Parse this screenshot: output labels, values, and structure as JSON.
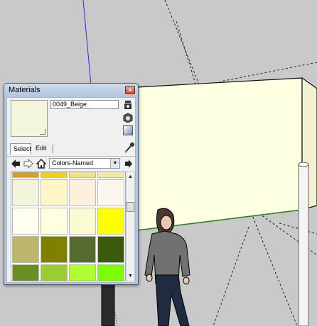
{
  "window": {
    "title": "Materials",
    "close_glyph": "×"
  },
  "material": {
    "name": "0049_Beige",
    "preview_color": "#f5f5dc"
  },
  "icons": {
    "display_in_model": "eye-icon",
    "create_material": "cube-plus-icon",
    "default_material": "shade-icon",
    "sample_paint": "eyedropper-icon",
    "back": "back-arrow-icon",
    "forward": "forward-arrow-icon",
    "home": "home-icon",
    "details": "details-arrow-icon"
  },
  "tabs": {
    "select_label": "Select",
    "edit_label": "Edit"
  },
  "library": {
    "selected": "Colors-Named",
    "dropdown_glyph": "▼"
  },
  "scroll": {
    "up_glyph": "▲",
    "down_glyph": "▼"
  },
  "swatches": [
    [
      "#d8a020",
      "#f2d200",
      "#f2e07a",
      "#f2e9a0"
    ],
    [
      "#f3f3dc",
      "#fff6c8",
      "#fdf0da",
      "#fcf6ec"
    ],
    [
      "#fffff0",
      "#ffffe0",
      "#fafad2",
      "#ffff00"
    ],
    [
      "#bdb76b",
      "#808000",
      "#556b2f",
      "#3b5a0a"
    ],
    [
      "#6b8e23",
      "#9acd32",
      "#adff2f",
      "#7cfc00"
    ]
  ]
}
